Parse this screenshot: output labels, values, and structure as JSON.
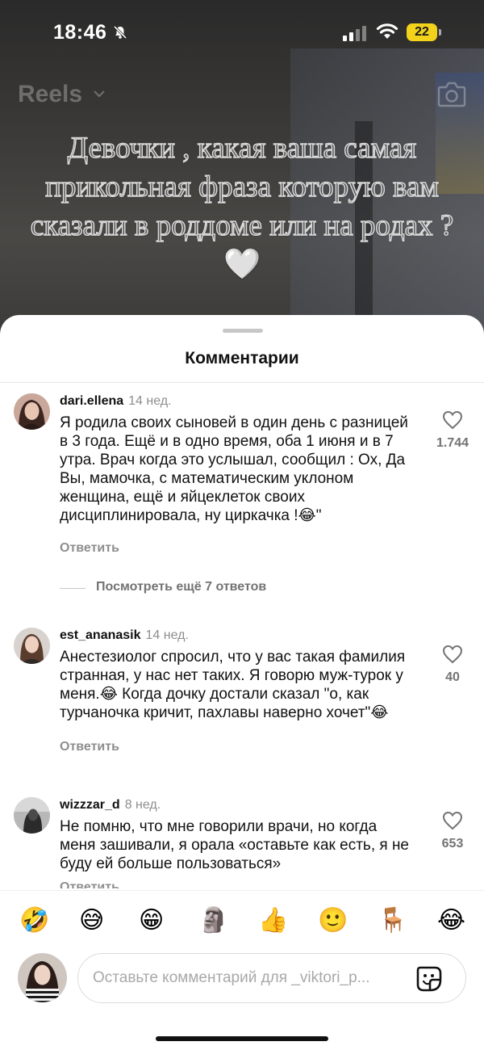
{
  "status_bar": {
    "time": "18:46",
    "battery": "22"
  },
  "reel": {
    "title": "Reels",
    "caption": "Девочки , какая ваша самая прикольная фраза которую вам сказали в роддоме или на родах ? 🤍"
  },
  "sheet": {
    "title": "Комментарии"
  },
  "comments": [
    {
      "username": "dari.ellena",
      "time": "14 нед.",
      "text": "Я родила своих сыновей в один день с разницей в 3 года. Ещё и в одно время, оба 1 июня и в 7 утра. Врач когда это услышал, сообщил :  Ох, Да Вы, мамочка, с математическим уклоном женщина, ещё и яйцеклеток своих дисциплинировала, ну циркачка !😂\"",
      "reply": "Ответить",
      "likes": "1.744",
      "more_replies": "Посмотреть ещё 7 ответов"
    },
    {
      "username": "est_ananasik",
      "time": "14 нед.",
      "text": "Анестезиолог спросил, что у вас такая фамилия странная, у нас нет таких. Я говорю муж-турок у меня.😂 Когда дочку достали сказал \"о, как турчаночка кричит, пахлавы наверно хочет\"😂",
      "reply": "Ответить",
      "likes": "40"
    },
    {
      "username": "wizzzar_d",
      "time": "8 нед.",
      "text": "Не помню, что мне говорили врачи, но когда меня зашивали, я орала «оставьте как есть, я не буду ей больше пользоваться»",
      "reply": "Ответить",
      "likes": "653"
    }
  ],
  "emoji_bar": [
    "🤣",
    "😅",
    "😁",
    "🗿",
    "👍",
    "🙂",
    "🪑",
    "😂"
  ],
  "composer": {
    "placeholder": "Оставьте комментарий для _viktori_p..."
  },
  "colors": {
    "accent_battery": "#f2d21b",
    "text": "#111111",
    "muted": "#8e8e8e"
  }
}
